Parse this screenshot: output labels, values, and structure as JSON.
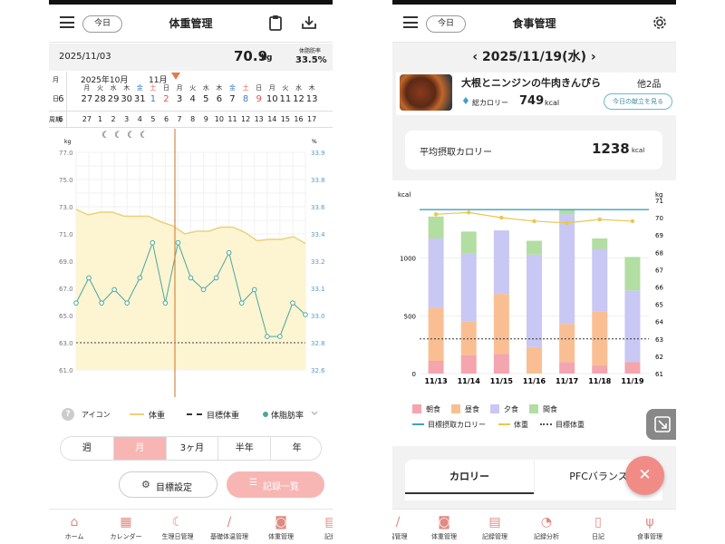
{
  "weight_screen": {
    "header": {
      "today": "今日",
      "title": "体重管理"
    },
    "summary": {
      "date": "2025/11/03",
      "weight": "70.9",
      "weight_unit": "kg",
      "fat_label": "体脂肪率",
      "fat_value": "33.5%"
    },
    "calendar": {
      "row_labels": {
        "month": "月",
        "day": "日",
        "cycle": "周期"
      },
      "month1": "2025年10月",
      "month2": "11月",
      "weekdays": [
        "月",
        "火",
        "水",
        "木",
        "金",
        "土",
        "日",
        "月",
        "火",
        "水",
        "木",
        "金",
        "土",
        "日",
        "月",
        "火",
        "水",
        "木"
      ],
      "days": [
        "6",
        "27",
        "28",
        "29",
        "30",
        "31",
        "1",
        "2",
        "3",
        "4",
        "5",
        "6",
        "7",
        "8",
        "9",
        "10",
        "11",
        "12",
        "13"
      ],
      "cycle": [
        "6",
        "27",
        "1",
        "2",
        "3",
        "4",
        "5",
        "6",
        "7",
        "8",
        "9",
        "10",
        "11",
        "12",
        "13",
        "14",
        "15",
        "16",
        "17"
      ]
    },
    "chart": {
      "left_unit": "kg",
      "right_unit": "%",
      "left_ticks": [
        "77.0",
        "75.0",
        "73.0",
        "71.0",
        "69.0",
        "67.0",
        "65.0",
        "63.0",
        "61.0"
      ],
      "right_ticks": [
        "33.9",
        "33.8",
        "33.6",
        "33.4",
        "33.2",
        "33.1",
        "33.0",
        "32.8",
        "32.6"
      ]
    },
    "chart_data": {
      "type": "line",
      "y_left_range": [
        61,
        77
      ],
      "y_right_range": [
        32.6,
        33.9
      ],
      "series": [
        {
          "name": "体重",
          "values": [
            72.8,
            72.4,
            72.6,
            72.6,
            72.3,
            72.3,
            72.3,
            71.9,
            71.6,
            71.0,
            71.2,
            71.2,
            71.5,
            71.5,
            71.1,
            70.5,
            70.6,
            70.6,
            70.8,
            70.3
          ]
        },
        {
          "name": "体脂肪率",
          "values": [
            33.0,
            33.15,
            33.0,
            33.08,
            33.0,
            33.15,
            33.36,
            33.0,
            33.36,
            33.15,
            33.08,
            33.15,
            33.3,
            33.0,
            33.08,
            32.8,
            32.8,
            33.0,
            32.93
          ]
        }
      ],
      "target_weight": 63.0
    },
    "legend": {
      "icon": "アイコン",
      "weight": "体重",
      "target": "目標体重",
      "fat": "体脂肪率"
    },
    "periods": [
      "週",
      "月",
      "3ヶ月",
      "半年",
      "年"
    ],
    "buttons": {
      "goal": "目標設定",
      "list": "記録一覧"
    },
    "tabs": [
      "ホーム",
      "カレンダー",
      "生理日管理",
      "基礎体温管理",
      "体重管理",
      "記録"
    ],
    "colors": {
      "accent": "#f4a7a4",
      "weight_line": "#e8d27a",
      "fat_line": "#4aa89c",
      "fill": "#fdf4d2"
    }
  },
  "meal_screen": {
    "header": {
      "today": "今日",
      "title": "食事管理"
    },
    "date": "2025/11/19(水)",
    "meal_card": {
      "name": "大根とニンジンの牛肉きんぴら",
      "others": "他2品",
      "kcal_label": "総カロリー",
      "kcal_value": "749",
      "kcal_unit": "kcal",
      "button": "今日の献立を見る"
    },
    "average": {
      "label": "平均摂取カロリー",
      "value": "1238",
      "unit": "kcal"
    },
    "chart": {
      "left_unit": "kcal",
      "right_unit": "kg",
      "left_ticks": [
        "1000",
        "500",
        "0"
      ],
      "right_ticks": [
        "71",
        "70",
        "69",
        "68",
        "67",
        "66",
        "65",
        "64",
        "63",
        "62",
        "61"
      ]
    },
    "chart_data": {
      "type": "bar",
      "categories": [
        "11/13",
        "11/14",
        "11/15",
        "11/16",
        "11/17",
        "11/18",
        "11/19"
      ],
      "series": [
        {
          "name": "朝食",
          "values": [
            110,
            160,
            170,
            0,
            100,
            70,
            100
          ]
        },
        {
          "name": "昼食",
          "values": [
            460,
            290,
            520,
            230,
            330,
            470,
            0
          ]
        },
        {
          "name": "夕食",
          "values": [
            600,
            590,
            550,
            800,
            950,
            540,
            620
          ]
        },
        {
          "name": "間食",
          "values": [
            190,
            190,
            0,
            120,
            40,
            90,
            290
          ]
        }
      ],
      "weight_line": [
        70.2,
        70.3,
        70.0,
        69.8,
        69.7,
        69.9,
        69.8
      ],
      "target_calorie": 1420,
      "target_weight": 63.0,
      "y_left_range": [
        0,
        1500
      ],
      "y_right_range": [
        61,
        71
      ]
    },
    "legend": [
      "朝食",
      "昼食",
      "夕食",
      "間食",
      "目標摂取カロリー",
      "体重",
      "目標体重"
    ],
    "bottom_tabs": [
      "カロリー",
      "PFCバランス"
    ],
    "tabs": [
      "温管理",
      "体重管理",
      "記録管理",
      "記録分析",
      "日記",
      "食事管理"
    ],
    "colors": {
      "breakfast": "#f4a5ad",
      "lunch": "#f9bf93",
      "dinner": "#c9c7f3",
      "snack": "#b2dea1",
      "target_line": "#3aa3bd",
      "weight_line": "#e8c84a"
    }
  }
}
